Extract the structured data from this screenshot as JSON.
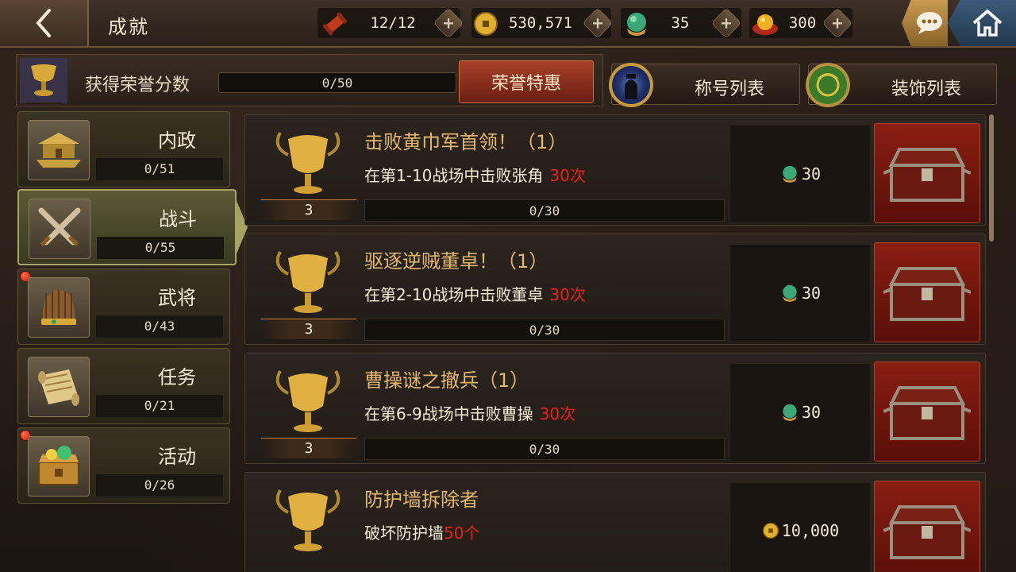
{
  "header": {
    "title": "成就",
    "resources": [
      {
        "icon": "scroll-icon",
        "value": "12/12"
      },
      {
        "icon": "coin-icon",
        "value": "530,571"
      },
      {
        "icon": "jade-icon",
        "value": "35"
      },
      {
        "icon": "gold-ingot-icon",
        "value": "300"
      }
    ]
  },
  "honor": {
    "label": "获得荣誉分数",
    "progress": "0/50",
    "special_button": "荣誉特惠",
    "title_list": "称号列表",
    "decoration_list": "装饰列表"
  },
  "categories": [
    {
      "name": "内政",
      "progress": "0/51",
      "icon": "palace-icon",
      "badge": false,
      "active": false
    },
    {
      "name": "战斗",
      "progress": "0/55",
      "icon": "crossed-swords-icon",
      "badge": false,
      "active": true
    },
    {
      "name": "武将",
      "progress": "0/43",
      "icon": "helmet-icon",
      "badge": true,
      "active": false
    },
    {
      "name": "任务",
      "progress": "0/21",
      "icon": "scroll-map-icon",
      "badge": false,
      "active": false
    },
    {
      "name": "活动",
      "progress": "0/26",
      "icon": "treasure-box-icon",
      "badge": true,
      "active": false
    }
  ],
  "achievements": [
    {
      "title": "击败黄巾军首领！（1）",
      "desc": "在第1-10战场中击败张角",
      "count": "30次",
      "points": "3",
      "progress": "0/30",
      "reward_icon": "jade-icon",
      "reward": "30"
    },
    {
      "title": "驱逐逆贼董卓！（1）",
      "desc": "在第2-10战场中击败董卓",
      "count": "30次",
      "points": "3",
      "progress": "0/30",
      "reward_icon": "jade-icon",
      "reward": "30"
    },
    {
      "title": "曹操谜之撤兵（1）",
      "desc": "在第6-9战场中击败曹操",
      "count": "30次",
      "points": "3",
      "progress": "0/30",
      "reward_icon": "jade-icon",
      "reward": "30"
    },
    {
      "title": "防护墙拆除者",
      "desc": "破坏防护墙",
      "count": "50个",
      "points": "",
      "progress": "",
      "reward_icon": "coin-icon",
      "reward": "10,000"
    }
  ],
  "colors": {
    "title_gold": "#e2b870",
    "count_red": "#e8221a",
    "active_tab": "#a8a468",
    "chest_red": "#8a1e12"
  }
}
